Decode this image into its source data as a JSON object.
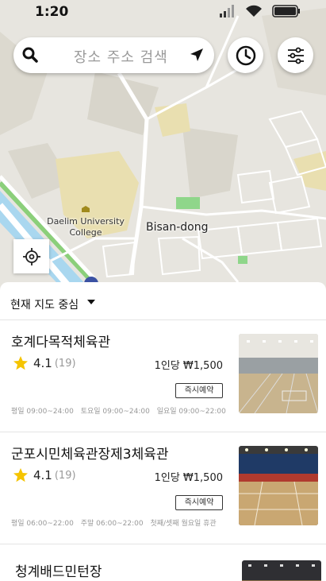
{
  "status": {
    "time": "1:20"
  },
  "search": {
    "placeholder": "장소 주소 검색"
  },
  "map": {
    "label_university": "Daelim University College",
    "label_district": "Bisan-dong"
  },
  "sheet": {
    "sort_label": "현재 지도 중심"
  },
  "venues": [
    {
      "name": "호계다목적체육관",
      "rating": "4.1",
      "reviews": "(19)",
      "price": "1인당 ₩1,500",
      "badge": "즉시예약",
      "hours": [
        "평일 09:00~24:00",
        "토요일 09:00~24:00",
        "일요일 09:00~22:00"
      ]
    },
    {
      "name": "군포시민체육관장제3체육관",
      "rating": "4.1",
      "reviews": "(19)",
      "price": "1인당 ₩1,500",
      "badge": "즉시예약",
      "hours": [
        "평일 06:00~22:00",
        "주말 06:00~22:00",
        "첫째/셋째 월요일 휴관"
      ]
    },
    {
      "name": "청계배드민턴장"
    }
  ],
  "colors": {
    "star": "#f5c400",
    "map_bg": "#e7e5df",
    "green": "#8fd68a",
    "road": "#ffffff"
  },
  "icons": [
    "signal-icon",
    "wifi-icon",
    "battery-icon",
    "search-icon",
    "navigation-arrow-icon",
    "clock-icon",
    "filter-sliders-icon",
    "gps-target-icon",
    "star-icon",
    "caret-down-icon"
  ]
}
